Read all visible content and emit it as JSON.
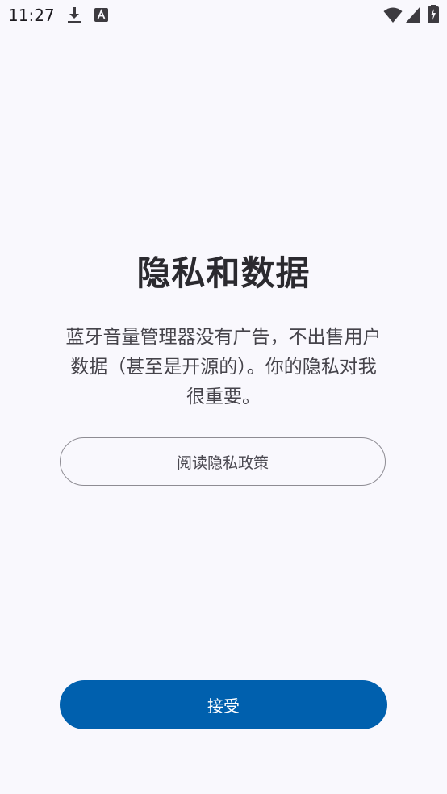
{
  "status_bar": {
    "time": "11:27",
    "icons": [
      "download-icon",
      "keyboard-a-icon",
      "wifi-icon",
      "signal-icon",
      "battery-charging-icon"
    ]
  },
  "privacy": {
    "title": "隐私和数据",
    "description": "蓝牙音量管理器没有广告，不出售用户数据（甚至是开源的）。你的隐私对我很重要。",
    "read_policy_label": "阅读隐私政策",
    "accept_label": "接受"
  },
  "colors": {
    "background": "#f9f8fd",
    "primary": "#0060ae",
    "outline": "#8e8c93",
    "title_text": "#2b2a2f",
    "body_text": "#45434a"
  }
}
